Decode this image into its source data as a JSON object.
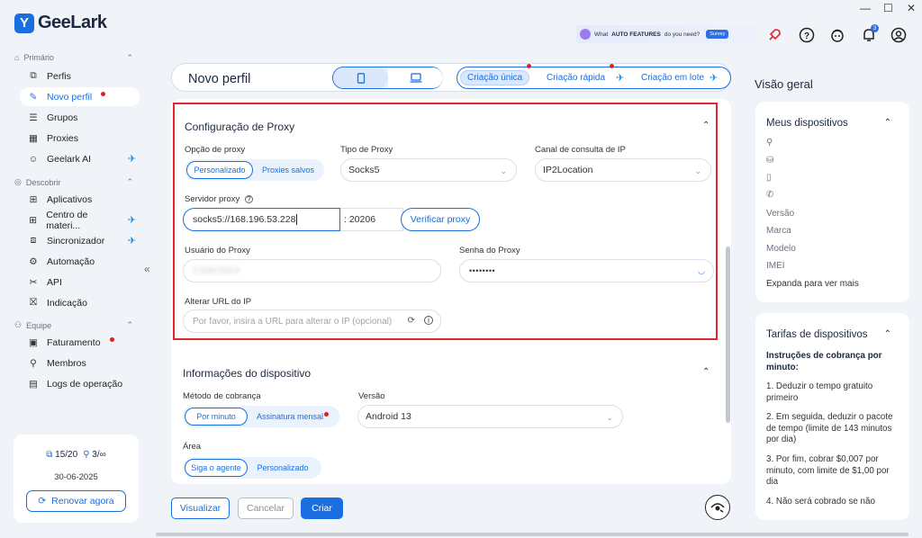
{
  "app": {
    "name": "GeeLark"
  },
  "window_controls": {
    "minimize": "—",
    "maximize": "☐",
    "close": "✕"
  },
  "banner": {
    "prefix": "What",
    "highlight": "AUTO FEATURES",
    "suffix": "do you need?",
    "survey": "Survey"
  },
  "notifications_badge": "3",
  "sidebar": {
    "sections": {
      "primary": "Primário",
      "discover": "Descobrir",
      "team": "Equipe"
    },
    "items": {
      "perfis": "Perfis",
      "novo_perfil": "Novo perfil",
      "grupos": "Grupos",
      "proxies": "Proxies",
      "geelark_ai": "Geelark AI",
      "aplicativos": "Aplicativos",
      "centro": "Centro de materi...",
      "sincronizador": "Sincronizador",
      "automacao": "Automação",
      "api": "API",
      "indicacao": "Indicação",
      "faturamento": "Faturamento",
      "membros": "Membros",
      "logs": "Logs de operação"
    },
    "account": {
      "profiles": "15/20",
      "members": "3/∞",
      "date": "30-06-2025",
      "renew": "Renovar agora"
    }
  },
  "header": {
    "title": "Novo perfil",
    "modes": {
      "single": "Criação única",
      "quick": "Criação rápida",
      "batch": "Criação em lote"
    }
  },
  "proxy": {
    "title": "Configuração de Proxy",
    "option_label": "Opção de proxy",
    "option_custom": "Personalizado",
    "option_saved": "Proxies salvos",
    "type_label": "Tipo de Proxy",
    "type_value": "Socks5",
    "ip_channel_label": "Canal de consulta de IP",
    "ip_channel_value": "IP2Location",
    "server_label": "Servidor proxy",
    "server_value": "socks5://168.196.53.228",
    "port_value": ": 20206",
    "verify": "Verificar proxy",
    "user_label": "Usuário do Proxy",
    "user_value": "CSAV25X4",
    "password_label": "Senha do Proxy",
    "password_value": "••••••••",
    "change_url_label": "Alterar URL do IP",
    "change_url_placeholder": "Por favor, insira a URL para alterar o IP (opcional)"
  },
  "device": {
    "title": "Informações do dispositivo",
    "billing_label": "Método de cobrança",
    "billing_minute": "Por minuto",
    "billing_subscription": "Assinatura mensal",
    "version_label": "Versão",
    "version_value": "Android 13",
    "area_label": "Área",
    "area_agent": "Siga o agente",
    "area_custom": "Personalizado"
  },
  "footer": {
    "preview": "Visualizar",
    "cancel": "Cancelar",
    "create": "Criar"
  },
  "overview": {
    "title": "Visão geral",
    "devices_title": "Meus dispositivos",
    "version": "Versão",
    "brand": "Marca",
    "model": "Modelo",
    "imei": "IMEI",
    "expand": "Expanda para ver mais",
    "rates_title": "Tarifas de dispositivos",
    "rates_heading": "Instruções de cobrança por minuto:",
    "rule1": "1. Deduzir o tempo gratuito primeiro",
    "rule2": "2. Em seguida, deduzir o pacote de tempo (limite de 143 minutos por dia)",
    "rule3": "3. Por fim, cobrar $0,007 por minuto, com limite de $1,00 por dia",
    "rule4": "4. Não será cobrado se não"
  },
  "colors": {
    "brand": "#1a6fe0",
    "alert": "#e5262b"
  }
}
